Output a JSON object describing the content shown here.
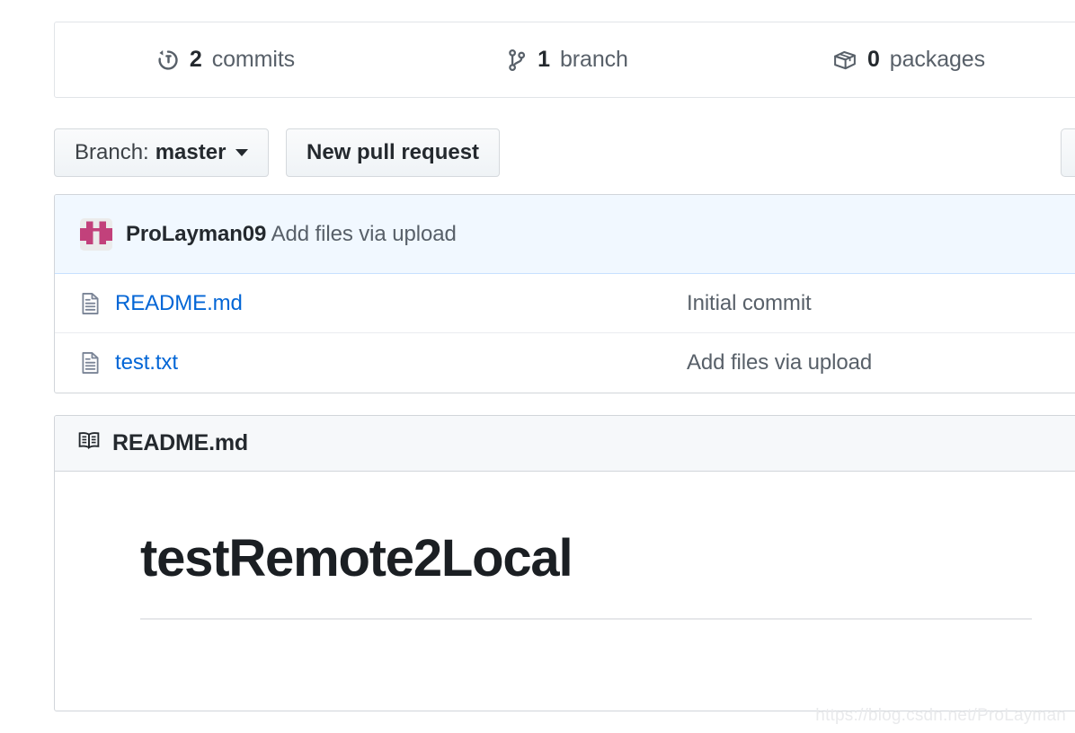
{
  "stats": {
    "items": [
      {
        "icon": "history-icon",
        "count": "2",
        "label": "commits"
      },
      {
        "icon": "git-branch-icon",
        "count": "1",
        "label": "branch"
      },
      {
        "icon": "package-icon",
        "count": "0",
        "label": "packages"
      }
    ]
  },
  "actions": {
    "branch_prefix": "Branch:",
    "branch_value": "master",
    "new_pull_request": "New pull request"
  },
  "latest_commit": {
    "author": "ProLayman09",
    "message": "Add files via upload"
  },
  "files": {
    "rows": [
      {
        "icon": "file-icon",
        "name": "README.md",
        "message": "Initial commit"
      },
      {
        "icon": "file-icon",
        "name": "test.txt",
        "message": "Add files via upload"
      }
    ]
  },
  "readme": {
    "icon": "book-icon",
    "title": "README.md",
    "heading": "testRemote2Local"
  },
  "watermark": "https://blog.csdn.net/ProLayman",
  "colors": {
    "link": "#0366d6",
    "text": "#24292e",
    "muted": "#586069",
    "border": "#d1d5da",
    "commit_bar_bg": "#f1f8ff",
    "header_bg": "#f6f8fa",
    "avatar_fg": "#c2417b",
    "avatar_bg": "#ebebeb"
  }
}
